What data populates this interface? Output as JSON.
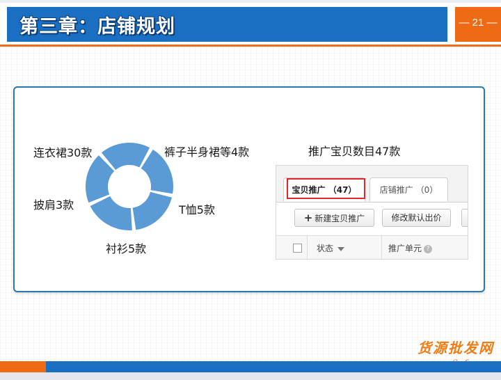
{
  "header": {
    "title": "第三章：店铺规划",
    "page_number": "— 21 —"
  },
  "diagram": {
    "segments": [
      {
        "label": "裤子半身裙等4款"
      },
      {
        "label": "T恤5款"
      },
      {
        "label": "衬衫5款"
      },
      {
        "label": "披肩3款"
      },
      {
        "label": "连衣裙30款"
      }
    ],
    "color": "#5b9bd5"
  },
  "promo": {
    "caption": "推广宝贝数目47款",
    "tabs": [
      {
        "label": "宝贝推广 （47）",
        "selected": true
      },
      {
        "label": "店铺推广 （0）",
        "selected": false
      }
    ],
    "buttons": {
      "new_label": "新建宝贝推广",
      "edit_label": "修改默认出价"
    },
    "table_headers": {
      "status": "状态",
      "unit": "推广单元"
    },
    "highlight_color": "#e0262a"
  },
  "footer": {
    "watermark_top": "货源批发网",
    "watermark_bottom": "www.6pf.cn"
  },
  "colors": {
    "blue": "#1a6fc2",
    "orange": "#ee6a14"
  }
}
